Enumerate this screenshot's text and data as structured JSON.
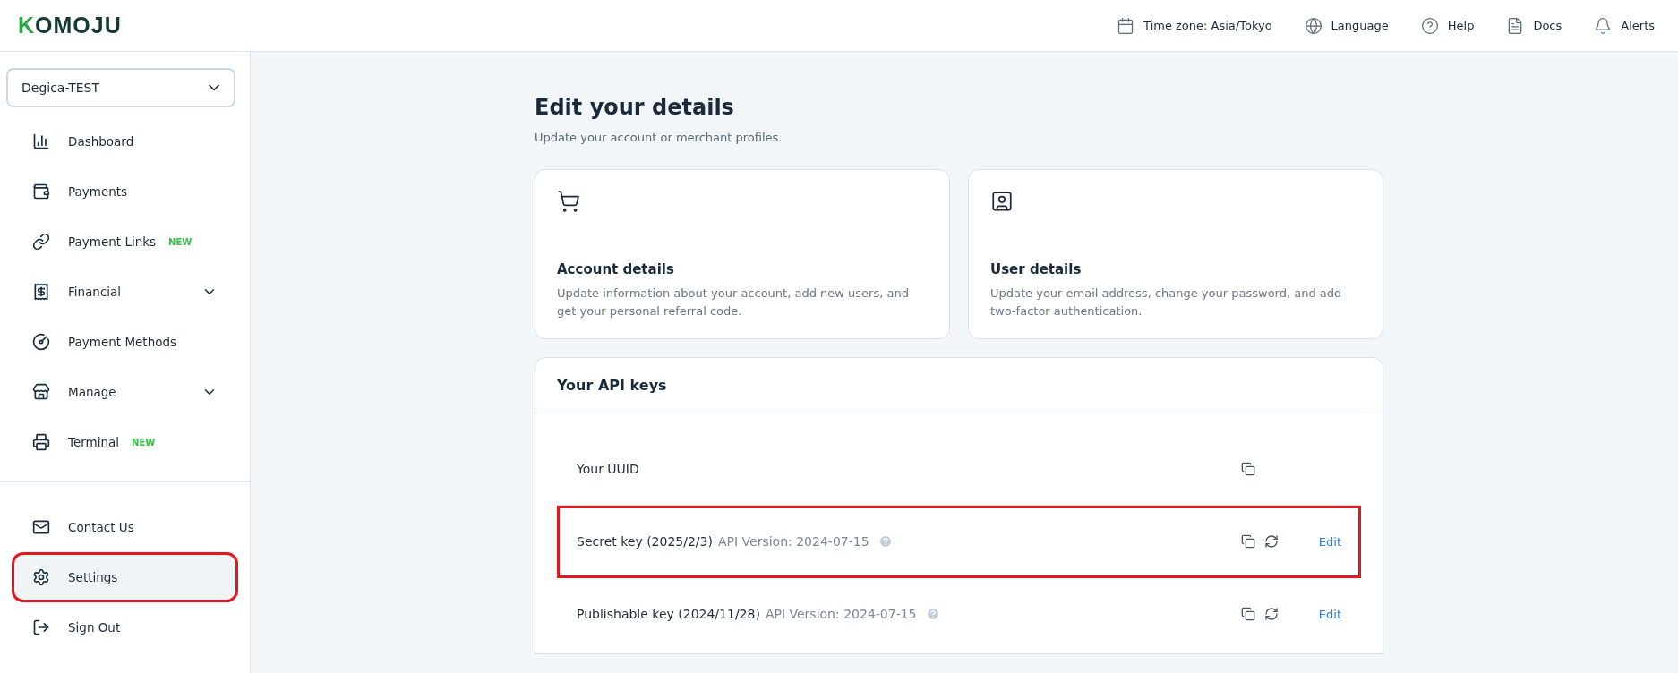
{
  "header": {
    "logo": "KOMOJU",
    "actions": [
      {
        "kind": "calendar",
        "label": "Time zone: Asia/Tokyo"
      },
      {
        "kind": "globe",
        "label": "Language"
      },
      {
        "kind": "help",
        "label": "Help"
      },
      {
        "kind": "docs",
        "label": "Docs"
      },
      {
        "kind": "bell",
        "label": "Alerts"
      }
    ]
  },
  "sidebar": {
    "account": "Degica-TEST",
    "items": [
      {
        "kind": "dashboard",
        "label": "Dashboard",
        "expandable": false
      },
      {
        "kind": "payments",
        "label": "Payments",
        "expandable": false
      },
      {
        "kind": "links",
        "label": "Payment Links",
        "badge": "NEW",
        "expandable": false
      },
      {
        "kind": "financial",
        "label": "Financial",
        "expandable": true
      },
      {
        "kind": "methods",
        "label": "Payment Methods",
        "expandable": false
      },
      {
        "kind": "manage",
        "label": "Manage",
        "expandable": true
      },
      {
        "kind": "terminal",
        "label": "Terminal",
        "badge": "NEW",
        "expandable": false
      }
    ],
    "bottom_items": [
      {
        "kind": "contact",
        "label": "Contact Us",
        "selected": false,
        "highlighted": false
      },
      {
        "kind": "settings",
        "label": "Settings",
        "selected": true,
        "highlighted": true
      },
      {
        "kind": "signout",
        "label": "Sign Out",
        "selected": false,
        "highlighted": false
      }
    ]
  },
  "page": {
    "title": "Edit your details",
    "subtitle": "Update your account or merchant profiles.",
    "cards": [
      {
        "kind": "cart",
        "title": "Account details",
        "description": "Update information about your account, add new users, and get your personal referral code."
      },
      {
        "kind": "user",
        "title": "User details",
        "description": "Update your email address, change your password, and add two-factor authentication."
      }
    ],
    "api_keys": {
      "title": "Your API keys",
      "rows": [
        {
          "label": "Your UUID",
          "refresh": false,
          "highlighted": false
        },
        {
          "label": "Secret key (2025/2/3)",
          "version": "API Version: 2024-07-15",
          "refresh": true,
          "edit": "Edit",
          "highlighted": true
        },
        {
          "label": "Publishable key (2024/11/28)",
          "version": "API Version: 2024-07-15",
          "refresh": true,
          "edit": "Edit",
          "highlighted": false
        }
      ]
    }
  }
}
